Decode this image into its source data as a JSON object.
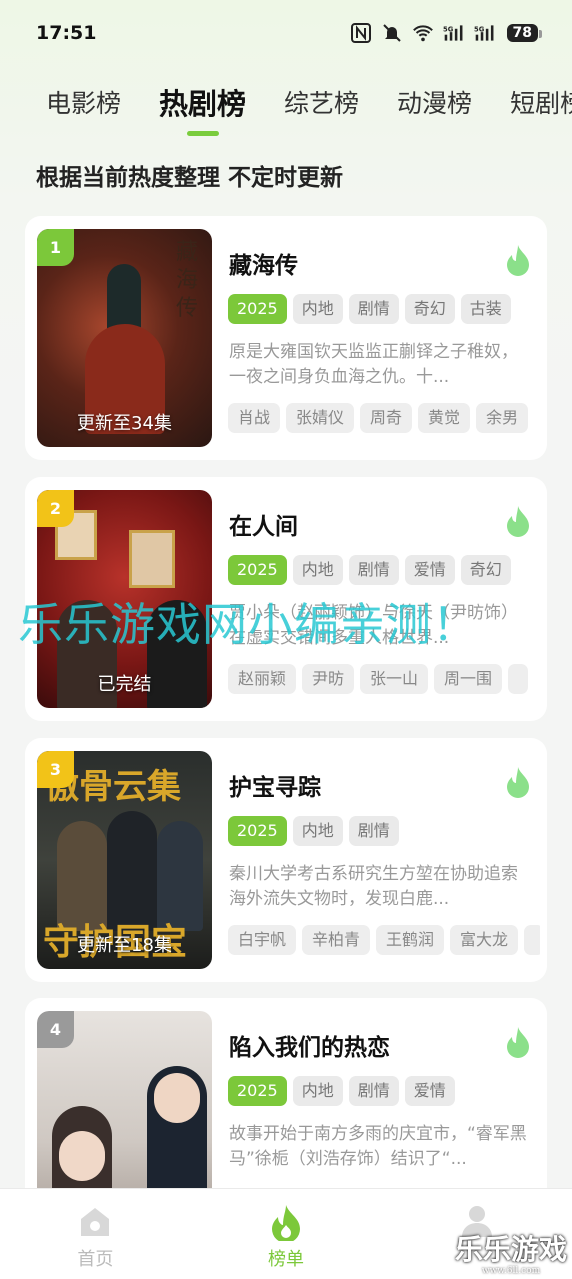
{
  "status_bar": {
    "time": "17:51",
    "battery": "78"
  },
  "tabs": [
    {
      "label": "电影榜"
    },
    {
      "label": "热剧榜"
    },
    {
      "label": "综艺榜"
    },
    {
      "label": "动漫榜"
    },
    {
      "label": "短剧榜"
    }
  ],
  "subtitle": "根据当前热度整理 不定时更新",
  "cards": [
    {
      "rank": "1",
      "rank_color": "#7cc83a",
      "title": "藏海传",
      "status": "更新至34集",
      "tags": [
        "2025",
        "内地",
        "剧情",
        "奇幻",
        "古装"
      ],
      "description": "原是大雍国钦天监监正蒯铎之子稚奴，一夜之间身负血海之仇。十...",
      "actors": [
        "肖战",
        "张婧仪",
        "周奇",
        "黄觉",
        "余男"
      ]
    },
    {
      "rank": "2",
      "rank_color": "#f2c318",
      "title": "在人间",
      "status": "已完结",
      "tags": [
        "2025",
        "内地",
        "剧情",
        "爱情",
        "奇幻"
      ],
      "description": "贾小朵（赵丽颖饰）与徐天（尹昉饰）在虚实交错间多重人格世界...",
      "actors": [
        "赵丽颖",
        "尹昉",
        "张一山",
        "周一围",
        ""
      ]
    },
    {
      "rank": "3",
      "rank_color": "#f2c318",
      "title": "护宝寻踪",
      "status": "更新至18集",
      "tags": [
        "2025",
        "内地",
        "剧情"
      ],
      "description": "秦川大学考古系研究生方堃在协助追索海外流失文物时，发现白鹿...",
      "actors": [
        "白宇帆",
        "辛柏青",
        "王鹤润",
        "富大龙",
        ""
      ]
    },
    {
      "rank": "4",
      "rank_color": "#9a9a9a",
      "title": "陷入我们的热恋",
      "status": "",
      "tags": [
        "2025",
        "内地",
        "剧情",
        "爱情"
      ],
      "description": "故事开始于南方多雨的庆宜市，“睿军黑马”徐栀（刘浩存饰）结识了“...",
      "actors": []
    }
  ],
  "watermark": "乐乐游戏网小编亲测！",
  "corner_watermark": {
    "title": "乐乐游戏",
    "url": "www.6ll.com"
  },
  "bottom_nav": [
    {
      "label": "首页",
      "icon": "home-icon"
    },
    {
      "label": "榜单",
      "icon": "flame-icon"
    },
    {
      "label": "",
      "icon": "profile-icon"
    }
  ],
  "colors": {
    "accent": "#7cc83a",
    "flame": "#8be08a"
  }
}
